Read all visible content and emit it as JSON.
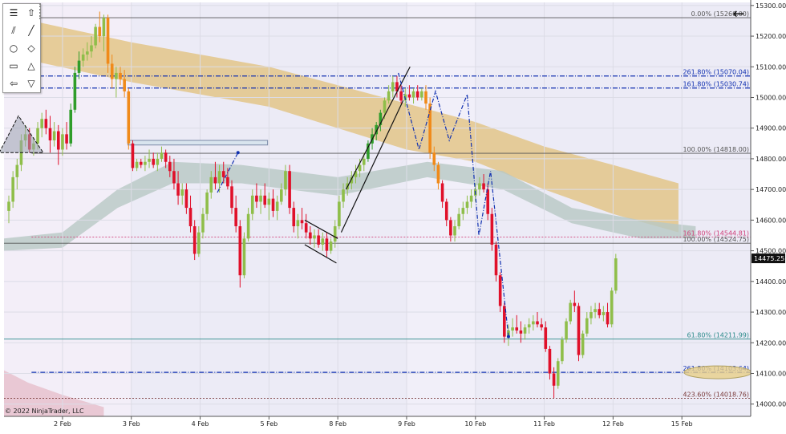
{
  "copyright": "© 2022 NinjaTrader, LLC",
  "toolbar": {
    "items": [
      {
        "icon": "menu-icon",
        "glyph": "☰"
      },
      {
        "icon": "up-arrow-icon",
        "glyph": "⇧"
      },
      {
        "icon": "parallel-lines-icon",
        "glyph": "⫽"
      },
      {
        "icon": "line-icon",
        "glyph": "╱"
      },
      {
        "icon": "circle-icon",
        "glyph": "○"
      },
      {
        "icon": "diamond-icon",
        "glyph": "◇"
      },
      {
        "icon": "rectangle-icon",
        "glyph": "▭"
      },
      {
        "icon": "triangle-up-icon",
        "glyph": "△"
      },
      {
        "icon": "arrow-left-icon",
        "glyph": "⇦"
      },
      {
        "icon": "triangle-down-icon",
        "glyph": "▽"
      }
    ]
  },
  "back_button": {
    "icon": "back-arrow-icon",
    "glyph": "←"
  },
  "colors": {
    "up": "#8fbe4a",
    "up_strong": "#2f9d2a",
    "down": "#e0102a",
    "down_orange": "#f08a1a",
    "fib_blue": "#1030b0",
    "fib_gray": "#555555",
    "fib_pink": "#d0407a",
    "fib_teal": "#2a8a8a",
    "cloud_tan": "#e2c07a",
    "cloud_gray": "#b8c8c4"
  },
  "chart_data": {
    "type": "candlestick",
    "x_labels": [
      "2 Feb",
      "3 Feb",
      "4 Feb",
      "5 Feb",
      "8 Feb",
      "9 Feb",
      "10 Feb",
      "11 Feb",
      "12 Feb",
      "15 Feb"
    ],
    "x_label_days": [
      1,
      2,
      3,
      4,
      5,
      6,
      7,
      8,
      9,
      10
    ],
    "x_range": [
      0.15,
      11.0
    ],
    "y_range": [
      13960,
      15310
    ],
    "y_ticks": [
      14000,
      14100,
      14200,
      14300,
      14400,
      14500,
      14600,
      14700,
      14800,
      14900,
      15000,
      15100,
      15200,
      15300
    ],
    "y_tick_labels": [
      "14000.00",
      "14100.00",
      "14200.00",
      "14300.00",
      "14400.00",
      "14500.00",
      "14600.00",
      "14700.00",
      "14800.00",
      "14900.00",
      "15000.00",
      "15100.00",
      "15200.00",
      "15300.00"
    ],
    "last_price": {
      "value": 14475.25,
      "label": "14475.25"
    },
    "fib_levels": [
      {
        "price": 15260.0,
        "label": "0.00% (15260.00)",
        "color": "#555555",
        "style": "solid",
        "x_from": 0.55
      },
      {
        "price": 15070.04,
        "label": "261.80% (15070.04)",
        "color": "#1030b0",
        "style": "dashdot",
        "x_from": 0.15
      },
      {
        "price": 15030.74,
        "label": "161.80% (15030.74)",
        "color": "#1030b0",
        "style": "dashdot",
        "x_from": 0.15
      },
      {
        "price": 14818.0,
        "label": "100.00% (14818.00)",
        "color": "#555555",
        "style": "solid",
        "x_from": 0.55
      },
      {
        "price": 14544.81,
        "label": "161.80% (14544.81)",
        "color": "#d0407a",
        "style": "dotted",
        "x_from": 0.55
      },
      {
        "price": 14524.75,
        "label": "100.00% (14524.75)",
        "color": "#555555",
        "style": "solid",
        "x_from": 0.15
      },
      {
        "price": 14211.99,
        "label": "61.80% (14211.99)",
        "color": "#2a8a8a",
        "style": "solid",
        "x_from": 0.15
      },
      {
        "price": 14103.64,
        "label": "261.80% (14103.64)",
        "color": "#1030b0",
        "style": "dashdot",
        "x_from": 0.55
      },
      {
        "price": 14018.76,
        "label": "423.60% (14018.76)",
        "color": "#7a3a3a",
        "style": "dotted",
        "x_from": 0.15
      }
    ],
    "candles": [
      [
        0.22,
        14630,
        14680,
        14590,
        14660
      ],
      [
        0.28,
        14660,
        14760,
        14640,
        14740
      ],
      [
        0.34,
        14740,
        14800,
        14700,
        14780
      ],
      [
        0.4,
        14780,
        14880,
        14760,
        14860
      ],
      [
        0.46,
        14860,
        14910,
        14840,
        14880
      ],
      [
        0.52,
        14880,
        14900,
        14820,
        14830
      ],
      [
        0.58,
        14830,
        14870,
        14810,
        14850
      ],
      [
        0.64,
        14850,
        14920,
        14830,
        14900
      ],
      [
        0.7,
        14900,
        14950,
        14870,
        14930
      ],
      [
        0.76,
        14930,
        14960,
        14880,
        14900
      ],
      [
        0.82,
        14900,
        14940,
        14820,
        14860
      ],
      [
        0.88,
        14860,
        14920,
        14840,
        14890
      ],
      [
        0.94,
        14890,
        14910,
        14780,
        14830
      ],
      [
        1.0,
        14830,
        14900,
        14810,
        14880
      ],
      [
        1.06,
        14880,
        14920,
        14830,
        14850
      ],
      [
        1.12,
        14850,
        14980,
        14840,
        14960
      ],
      [
        1.18,
        14960,
        15100,
        14950,
        15080
      ],
      [
        1.24,
        15080,
        15150,
        15060,
        15120
      ],
      [
        1.3,
        15120,
        15160,
        15100,
        15140
      ],
      [
        1.36,
        15140,
        15180,
        15120,
        15150
      ],
      [
        1.42,
        15150,
        15200,
        15130,
        15170
      ],
      [
        1.48,
        15170,
        15240,
        15160,
        15230
      ],
      [
        1.54,
        15230,
        15280,
        15180,
        15200
      ],
      [
        1.6,
        15200,
        15270,
        15150,
        15260
      ],
      [
        1.66,
        15260,
        15270,
        15080,
        15110
      ],
      [
        1.72,
        15110,
        15140,
        15030,
        15060
      ],
      [
        1.78,
        15060,
        15100,
        15000,
        15080
      ],
      [
        1.84,
        15080,
        15100,
        15040,
        15060
      ],
      [
        1.9,
        15060,
        15090,
        15000,
        15020
      ],
      [
        1.96,
        15020,
        15030,
        14830,
        14850
      ],
      [
        2.02,
        14850,
        14860,
        14760,
        14770
      ],
      [
        2.08,
        14770,
        14800,
        14760,
        14790
      ],
      [
        2.14,
        14790,
        14800,
        14770,
        14780
      ],
      [
        2.2,
        14780,
        14810,
        14760,
        14790
      ],
      [
        2.26,
        14790,
        14830,
        14770,
        14800
      ],
      [
        2.32,
        14800,
        14820,
        14770,
        14780
      ],
      [
        2.38,
        14780,
        14820,
        14760,
        14800
      ],
      [
        2.44,
        14800,
        14840,
        14790,
        14820
      ],
      [
        2.5,
        14820,
        14830,
        14770,
        14790
      ],
      [
        2.56,
        14790,
        14810,
        14740,
        14760
      ],
      [
        2.62,
        14760,
        14800,
        14700,
        14720
      ],
      [
        2.68,
        14720,
        14760,
        14650,
        14680
      ],
      [
        2.74,
        14680,
        14720,
        14650,
        14700
      ],
      [
        2.8,
        14700,
        14720,
        14620,
        14640
      ],
      [
        2.86,
        14640,
        14680,
        14560,
        14580
      ],
      [
        2.92,
        14580,
        14600,
        14470,
        14490
      ],
      [
        2.98,
        14490,
        14580,
        14480,
        14560
      ],
      [
        3.04,
        14560,
        14640,
        14540,
        14620
      ],
      [
        3.1,
        14620,
        14700,
        14600,
        14690
      ],
      [
        3.16,
        14690,
        14760,
        14670,
        14740
      ],
      [
        3.22,
        14740,
        14790,
        14700,
        14720
      ],
      [
        3.28,
        14720,
        14780,
        14690,
        14760
      ],
      [
        3.34,
        14760,
        14790,
        14720,
        14740
      ],
      [
        3.4,
        14740,
        14770,
        14700,
        14710
      ],
      [
        3.46,
        14710,
        14730,
        14620,
        14640
      ],
      [
        3.52,
        14640,
        14680,
        14560,
        14580
      ],
      [
        3.58,
        14580,
        14600,
        14380,
        14420
      ],
      [
        3.64,
        14420,
        14560,
        14410,
        14540
      ],
      [
        3.7,
        14540,
        14640,
        14530,
        14620
      ],
      [
        3.76,
        14620,
        14700,
        14600,
        14680
      ],
      [
        3.82,
        14680,
        14720,
        14640,
        14660
      ],
      [
        3.88,
        14660,
        14700,
        14620,
        14680
      ],
      [
        3.94,
        14680,
        14720,
        14640,
        14650
      ],
      [
        4.0,
        14650,
        14690,
        14600,
        14670
      ],
      [
        4.06,
        14670,
        14700,
        14610,
        14630
      ],
      [
        4.12,
        14630,
        14680,
        14600,
        14660
      ],
      [
        4.18,
        14660,
        14720,
        14650,
        14700
      ],
      [
        4.24,
        14700,
        14780,
        14680,
        14760
      ],
      [
        4.3,
        14760,
        14780,
        14620,
        14640
      ],
      [
        4.36,
        14640,
        14660,
        14560,
        14580
      ],
      [
        4.42,
        14580,
        14620,
        14540,
        14600
      ],
      [
        4.48,
        14600,
        14640,
        14570,
        14590
      ],
      [
        4.54,
        14590,
        14620,
        14540,
        14560
      ],
      [
        4.6,
        14560,
        14580,
        14520,
        14540
      ],
      [
        4.66,
        14540,
        14570,
        14510,
        14550
      ],
      [
        4.72,
        14550,
        14570,
        14510,
        14520
      ],
      [
        4.78,
        14520,
        14560,
        14500,
        14540
      ],
      [
        4.84,
        14540,
        14560,
        14480,
        14500
      ],
      [
        4.9,
        14500,
        14540,
        14490,
        14530
      ],
      [
        4.96,
        14530,
        14600,
        14510,
        14580
      ],
      [
        5.02,
        14580,
        14680,
        14570,
        14660
      ],
      [
        5.08,
        14660,
        14720,
        14640,
        14700
      ],
      [
        5.14,
        14700,
        14740,
        14680,
        14720
      ],
      [
        5.2,
        14720,
        14760,
        14700,
        14740
      ],
      [
        5.26,
        14740,
        14780,
        14720,
        14760
      ],
      [
        5.32,
        14760,
        14800,
        14740,
        14780
      ],
      [
        5.38,
        14780,
        14820,
        14760,
        14800
      ],
      [
        5.44,
        14800,
        14860,
        14790,
        14850
      ],
      [
        5.5,
        14850,
        14900,
        14830,
        14880
      ],
      [
        5.56,
        14880,
        14920,
        14860,
        14910
      ],
      [
        5.62,
        14910,
        14960,
        14890,
        14950
      ],
      [
        5.68,
        14950,
        15000,
        14930,
        14990
      ],
      [
        5.74,
        14990,
        15040,
        14980,
        15020
      ],
      [
        5.8,
        15020,
        15070,
        15000,
        15050
      ],
      [
        5.86,
        15050,
        15070,
        15000,
        15020
      ],
      [
        5.92,
        15020,
        15040,
        14980,
        14990
      ],
      [
        5.98,
        14990,
        15030,
        14970,
        15010
      ],
      [
        6.04,
        15010,
        15040,
        14990,
        15000
      ],
      [
        6.1,
        15000,
        15030,
        14980,
        15020
      ],
      [
        6.16,
        15020,
        15040,
        14990,
        15000
      ],
      [
        6.22,
        15000,
        15030,
        14990,
        15020
      ],
      [
        6.28,
        15020,
        15040,
        14960,
        14980
      ],
      [
        6.34,
        14980,
        15000,
        14800,
        14820
      ],
      [
        6.4,
        14820,
        14840,
        14760,
        14780
      ],
      [
        6.46,
        14780,
        14790,
        14700,
        14720
      ],
      [
        6.52,
        14720,
        14730,
        14640,
        14660
      ],
      [
        6.58,
        14660,
        14670,
        14580,
        14600
      ],
      [
        6.64,
        14600,
        14610,
        14530,
        14550
      ],
      [
        6.7,
        14550,
        14600,
        14530,
        14580
      ],
      [
        6.76,
        14580,
        14640,
        14570,
        14620
      ],
      [
        6.82,
        14620,
        14660,
        14600,
        14640
      ],
      [
        6.88,
        14640,
        14680,
        14620,
        14660
      ],
      [
        6.94,
        14660,
        14700,
        14640,
        14680
      ],
      [
        7.0,
        14680,
        14720,
        14660,
        14700
      ],
      [
        7.06,
        14700,
        14740,
        14680,
        14720
      ],
      [
        7.12,
        14720,
        14750,
        14690,
        14700
      ],
      [
        7.18,
        14700,
        14720,
        14600,
        14620
      ],
      [
        7.24,
        14620,
        14640,
        14500,
        14520
      ],
      [
        7.3,
        14520,
        14530,
        14400,
        14420
      ],
      [
        7.36,
        14420,
        14430,
        14300,
        14320
      ],
      [
        7.42,
        14320,
        14330,
        14200,
        14220
      ],
      [
        7.48,
        14220,
        14260,
        14190,
        14240
      ],
      [
        7.54,
        14240,
        14280,
        14220,
        14250
      ],
      [
        7.6,
        14250,
        14290,
        14230,
        14240
      ],
      [
        7.66,
        14240,
        14270,
        14200,
        14230
      ],
      [
        7.72,
        14230,
        14260,
        14210,
        14250
      ],
      [
        7.78,
        14250,
        14280,
        14230,
        14260
      ],
      [
        7.84,
        14260,
        14290,
        14240,
        14270
      ],
      [
        7.9,
        14270,
        14300,
        14250,
        14260
      ],
      [
        7.96,
        14260,
        14280,
        14240,
        14250
      ],
      [
        8.02,
        14250,
        14270,
        14170,
        14180
      ],
      [
        8.08,
        14180,
        14190,
        14080,
        14100
      ],
      [
        8.14,
        14100,
        14120,
        14020,
        14060
      ],
      [
        8.2,
        14060,
        14150,
        14050,
        14140
      ],
      [
        8.26,
        14140,
        14220,
        14130,
        14210
      ],
      [
        8.32,
        14210,
        14280,
        14200,
        14270
      ],
      [
        8.38,
        14270,
        14340,
        14260,
        14330
      ],
      [
        8.44,
        14330,
        14370,
        14300,
        14320
      ],
      [
        8.5,
        14320,
        14330,
        14140,
        14160
      ],
      [
        8.56,
        14160,
        14240,
        14150,
        14230
      ],
      [
        8.62,
        14230,
        14300,
        14220,
        14280
      ],
      [
        8.68,
        14280,
        14320,
        14260,
        14300
      ],
      [
        8.74,
        14300,
        14330,
        14280,
        14310
      ],
      [
        8.8,
        14310,
        14330,
        14280,
        14290
      ],
      [
        8.86,
        14290,
        14320,
        14270,
        14300
      ],
      [
        8.92,
        14300,
        14330,
        14250,
        14260
      ],
      [
        8.98,
        14260,
        14380,
        14250,
        14370
      ],
      [
        9.04,
        14370,
        14490,
        14360,
        14475.25
      ]
    ],
    "annotations": {
      "triangle": [
        [
          0.08,
          14820
        ],
        [
          0.36,
          14940
        ],
        [
          0.72,
          14820
        ]
      ],
      "channel_rise": [
        [
          [
            5.12,
            14700
          ],
          [
            6.05,
            15100
          ]
        ],
        [
          [
            5.05,
            14560
          ],
          [
            5.95,
            14990
          ]
        ]
      ],
      "channel_flag": [
        [
          [
            4.52,
            14600
          ],
          [
            5.0,
            14540
          ]
        ],
        [
          [
            4.52,
            14520
          ],
          [
            4.98,
            14460
          ]
        ]
      ],
      "rect_zone": [
        [
          1.95,
          14860
        ],
        [
          3.98,
          14845
        ]
      ],
      "dashed_paths": [
        [
          [
            3.25,
            14690
          ],
          [
            3.55,
            14820
          ]
        ],
        [
          [
            5.88,
            15080
          ],
          [
            6.18,
            14830
          ],
          [
            6.42,
            15020
          ],
          [
            6.62,
            14860
          ],
          [
            6.88,
            15010
          ],
          [
            7.05,
            14550
          ],
          [
            7.22,
            14760
          ],
          [
            7.48,
            14220
          ]
        ]
      ]
    }
  }
}
